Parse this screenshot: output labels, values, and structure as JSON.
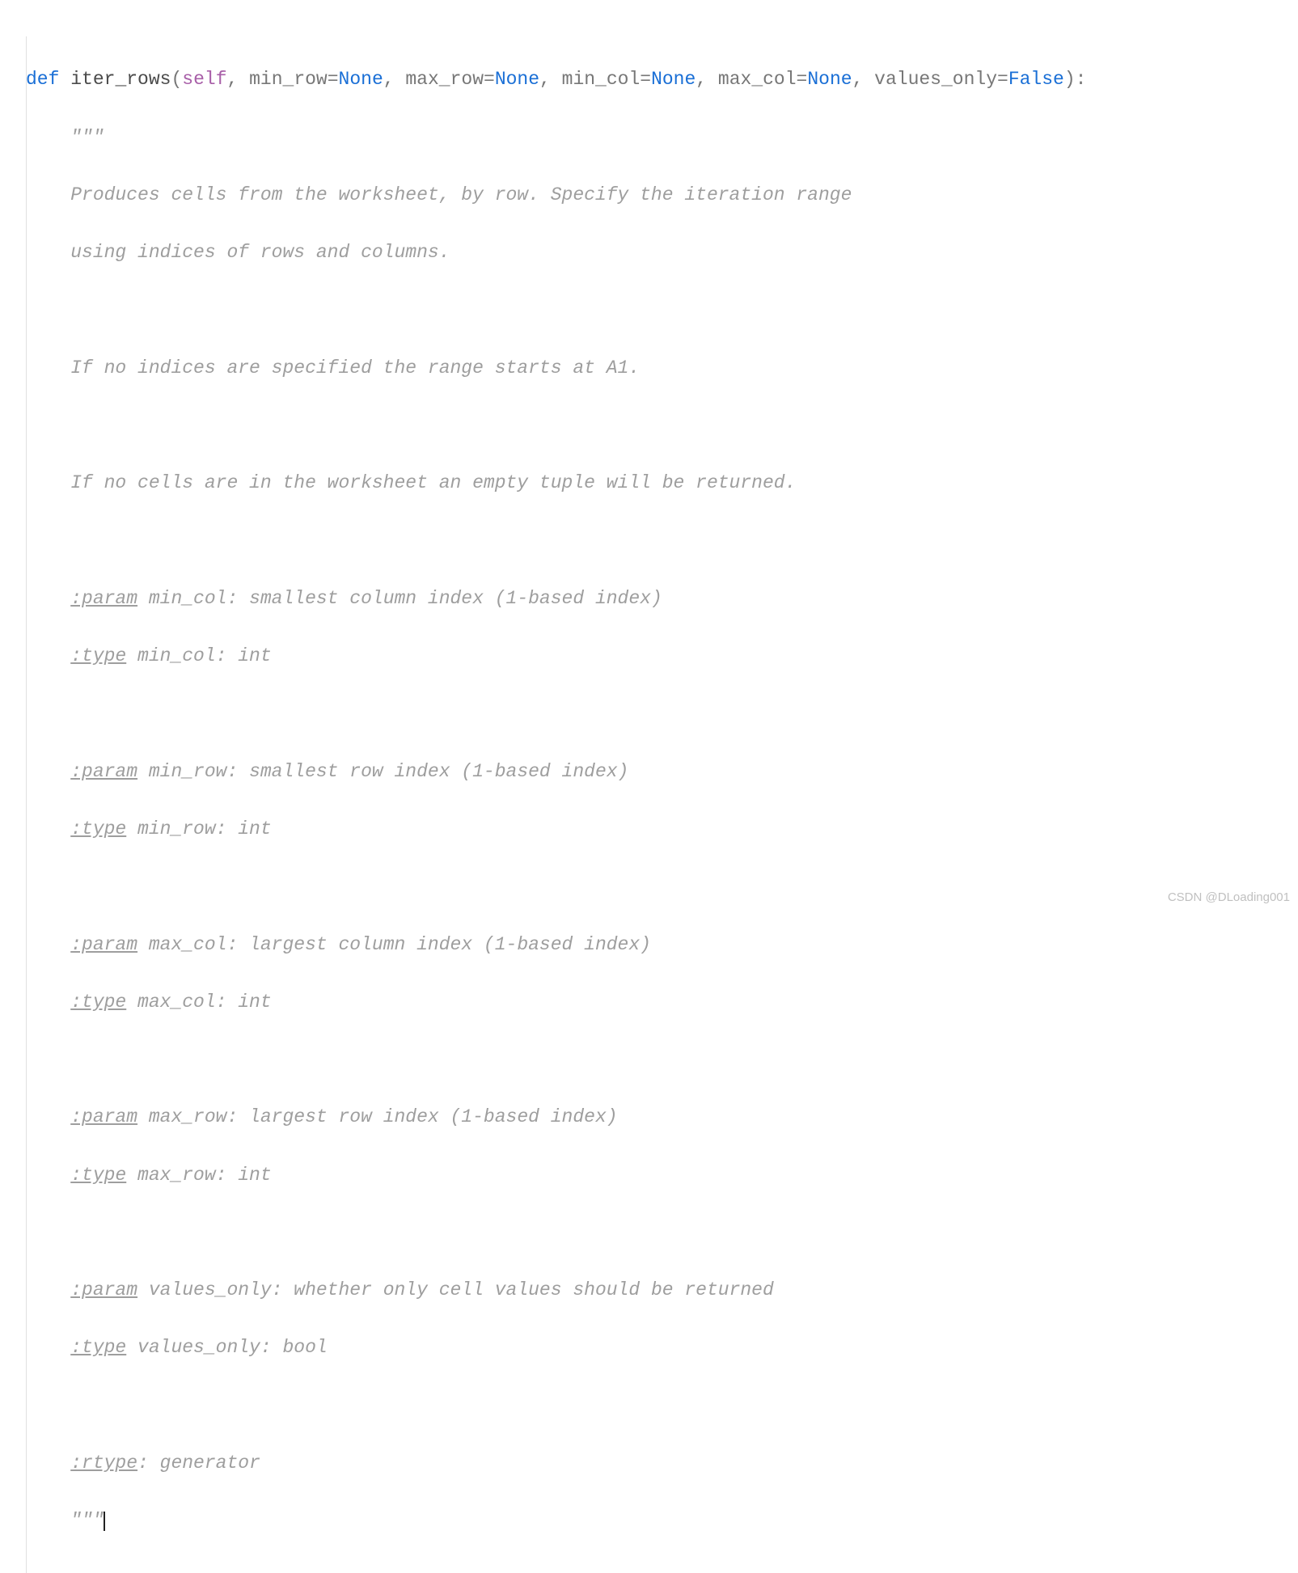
{
  "code": {
    "def_kw": "def",
    "fn_name": "iter_rows",
    "self_kw": "self",
    "params": {
      "p1_name": "min_row",
      "p1_default": "None",
      "p2_name": "max_row",
      "p2_default": "None",
      "p3_name": "min_col",
      "p3_default": "None",
      "p4_name": "max_col",
      "p4_default": "None",
      "p5_name": "values_only",
      "p5_default": "False"
    }
  },
  "doc": {
    "triple_open": "\"\"\"",
    "triple_close": "\"\"\"",
    "desc1": "Produces cells from the worksheet, by row. Specify the iteration range",
    "desc2": "using indices of rows and columns.",
    "desc3": "If no indices are specified the range starts at A1.",
    "desc4": "If no cells are in the worksheet an empty tuple will be returned.",
    "p_min_col_tag": ":param",
    "p_min_col_text": " min_col: smallest column index (1-based index)",
    "t_min_col_tag": ":type",
    "t_min_col_text": " min_col: int",
    "p_min_row_tag": ":param",
    "p_min_row_text": " min_row: smallest row index (1-based index)",
    "t_min_row_tag": ":type",
    "t_min_row_text": " min_row: int",
    "p_max_col_tag": ":param",
    "p_max_col_text": " max_col: largest column index (1-based index)",
    "t_max_col_tag": ":type",
    "t_max_col_text": " max_col: int",
    "p_max_row_tag": ":param",
    "p_max_row_text": " max_row: largest row index (1-based index)",
    "t_max_row_tag": ":type",
    "t_max_row_text": " max_row: int",
    "p_values_only_tag": ":param",
    "p_values_only_text": " values_only: whether only cell values should be returned",
    "t_values_only_tag": ":type",
    "t_values_only_text": " values_only: bool",
    "rtype_tag": ":rtype",
    "rtype_text": ": generator"
  },
  "watermark": "CSDN @DLoading001"
}
